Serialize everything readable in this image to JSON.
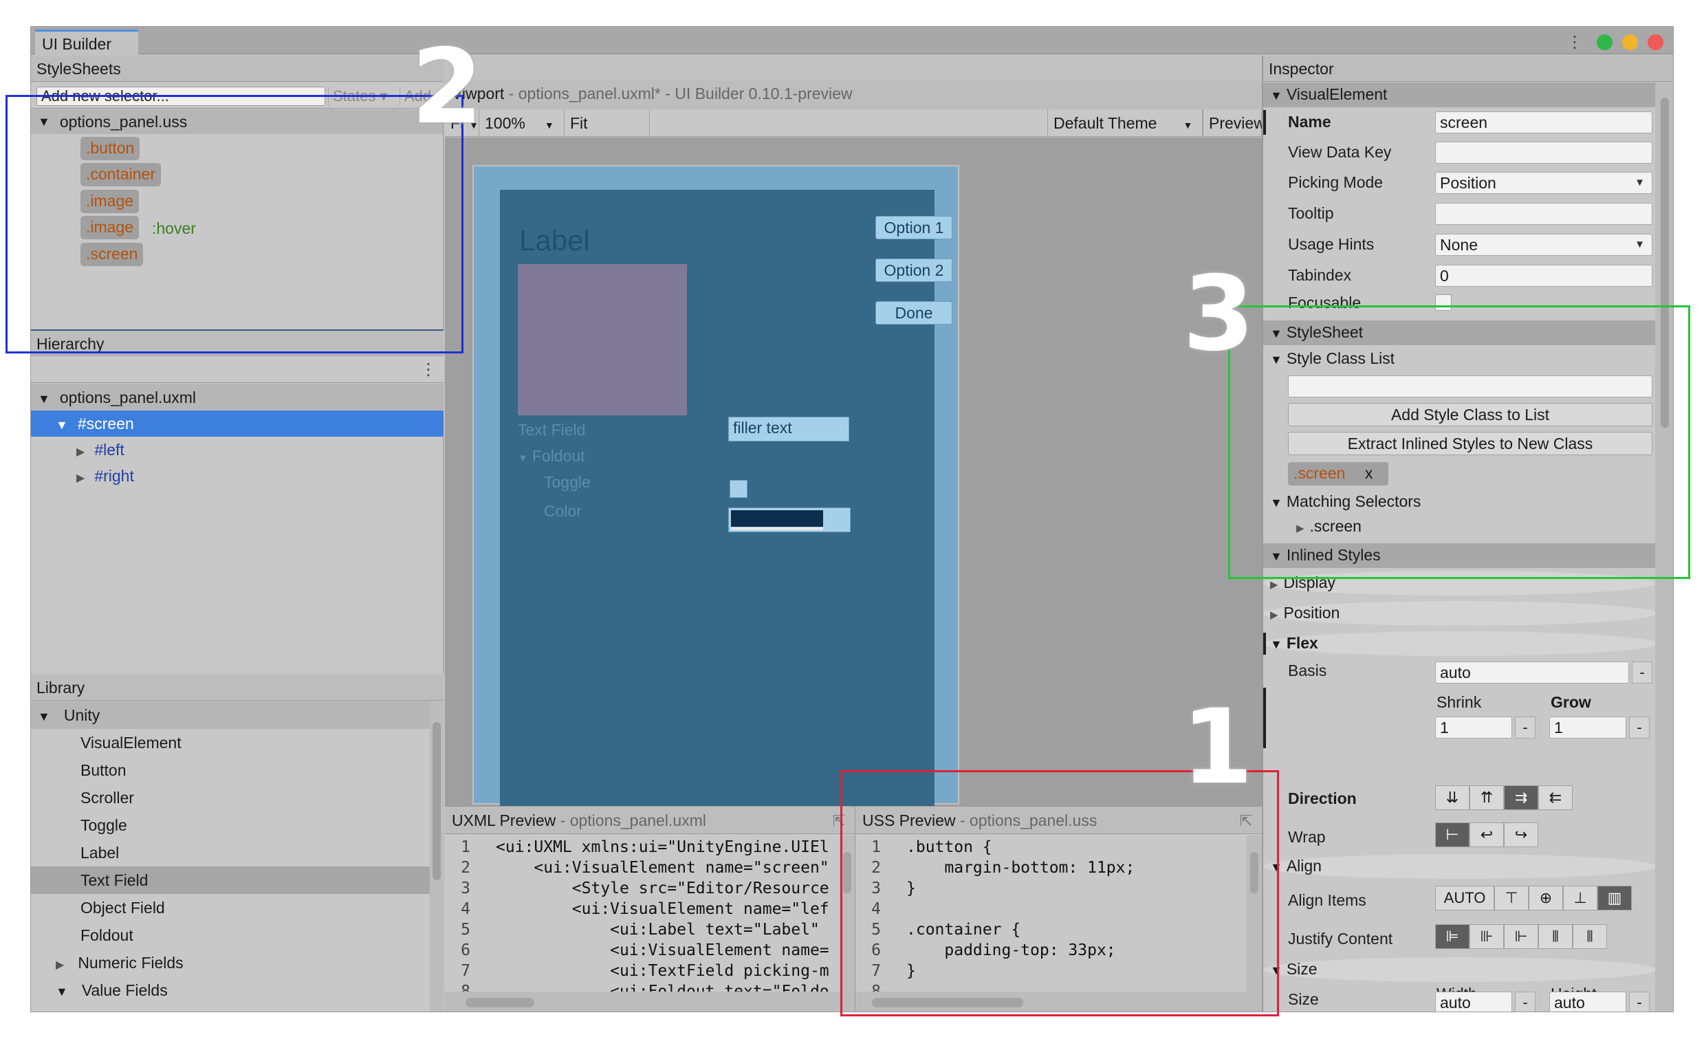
{
  "app": {
    "window_tab": "UI Builder",
    "traffic_lights": [
      "#2fb84a",
      "#f2b42a",
      "#ee5a55"
    ]
  },
  "stylesheets": {
    "header": "StyleSheets",
    "selector_placeholder": "Add new selector...",
    "states_label": "States ▾",
    "add_label": "Add",
    "file": "options_panel.uss",
    "selectors": [
      {
        "name": ".button"
      },
      {
        "name": ".container"
      },
      {
        "name": ".image"
      },
      {
        "name": ".image",
        "pseudo": ":hover"
      },
      {
        "name": ".screen"
      }
    ]
  },
  "hierarchy": {
    "header": "Hierarchy",
    "file": "options_panel.uxml",
    "items": [
      "#screen",
      "#left",
      "#right"
    ]
  },
  "library": {
    "header": "Library",
    "group": "Unity",
    "items": [
      "VisualElement",
      "Button",
      "Scroller",
      "Toggle",
      "Label",
      "Text Field",
      "Object Field",
      "Foldout",
      "Numeric Fields",
      "Value Fields"
    ],
    "selected": "Text Field"
  },
  "viewport": {
    "title_prefix": "Vi",
    "title_suffix": "wport",
    "file_info": " - options_panel.uxml* - UI Builder 0.10.1-preview",
    "fit_short": "Fi",
    "zoom": "100%",
    "fit_canvas": "Fit Canvas",
    "theme": "Default Theme",
    "preview": "Preview",
    "canvas": {
      "label": "Label",
      "options": [
        "Option 1",
        "Option 2",
        "Done"
      ],
      "text_field_label": "Text Field",
      "text_field_value": "filler text",
      "foldout_label": "Foldout",
      "toggle_label": "Toggle",
      "color_label": "Color"
    }
  },
  "uxml_preview": {
    "title": "UXML Preview",
    "file": " - options_panel.uxml",
    "line_numbers": [
      "1",
      "2",
      "3",
      "4",
      "5",
      "6",
      "7",
      "8"
    ],
    "lines": [
      "<ui:UXML xmlns:ui=\"UnityEngine.UIEl",
      "    <ui:VisualElement name=\"screen\"",
      "        <Style src=\"Editor/Resource",
      "        <ui:VisualElement name=\"lef",
      "            <ui:Label text=\"Label\"",
      "            <ui:VisualElement name=",
      "            <ui:TextField picking-m",
      "            <ui:Foldout text=\"Foldo"
    ]
  },
  "uss_preview": {
    "title": "USS Preview",
    "file": " - options_panel.uss",
    "line_numbers": [
      "1",
      "2",
      "3",
      "4",
      "5",
      "6",
      "7",
      "8"
    ],
    "lines": [
      ".button {",
      "    margin-bottom: 11px;",
      "}",
      "",
      ".container {",
      "    padding-top: 33px;",
      "}",
      ""
    ]
  },
  "inspector": {
    "header": "Inspector",
    "visual_element": "VisualElement",
    "name_label": "Name",
    "name_value": "screen",
    "view_data_key_label": "View Data Key",
    "picking_mode_label": "Picking Mode",
    "picking_mode_value": "Position",
    "tooltip_label": "Tooltip",
    "usage_hints_label": "Usage Hints",
    "usage_hints_value": "None",
    "tabindex_label": "Tabindex",
    "tabindex_value": "0",
    "focusable_label": "Focusable",
    "stylesheet": "StyleSheet",
    "style_class_list": "Style Class List",
    "add_style_class": "Add Style Class to List",
    "extract_inlined": "Extract Inlined Styles to New Class",
    "class_chip": ".screen",
    "class_chip_remove": "x",
    "matching_selectors": "Matching Selectors",
    "matching_item": ".screen",
    "inlined_styles": "Inlined Styles",
    "display": "Display",
    "position": "Position",
    "flex": "Flex",
    "basis_label": "Basis",
    "basis_value": "auto",
    "shrink_label": "Shrink",
    "shrink_value": "1",
    "grow_label": "Grow",
    "grow_value": "1",
    "direction_label": "Direction",
    "wrap_label": "Wrap",
    "align": "Align",
    "align_items_label": "Align Items",
    "align_items_auto": "AUTO",
    "justify_content_label": "Justify Content",
    "size": "Size",
    "width_label": "Width",
    "height_label": "Height",
    "size_label": "Size",
    "width_value": "auto",
    "height_value": "auto",
    "dash": "-"
  },
  "annotations": {
    "numbers": [
      "2",
      "3",
      "1"
    ],
    "colors": {
      "stylesheets": "#1f2fd6",
      "inspector": "#23c53a",
      "uss": "#e0203a"
    }
  }
}
